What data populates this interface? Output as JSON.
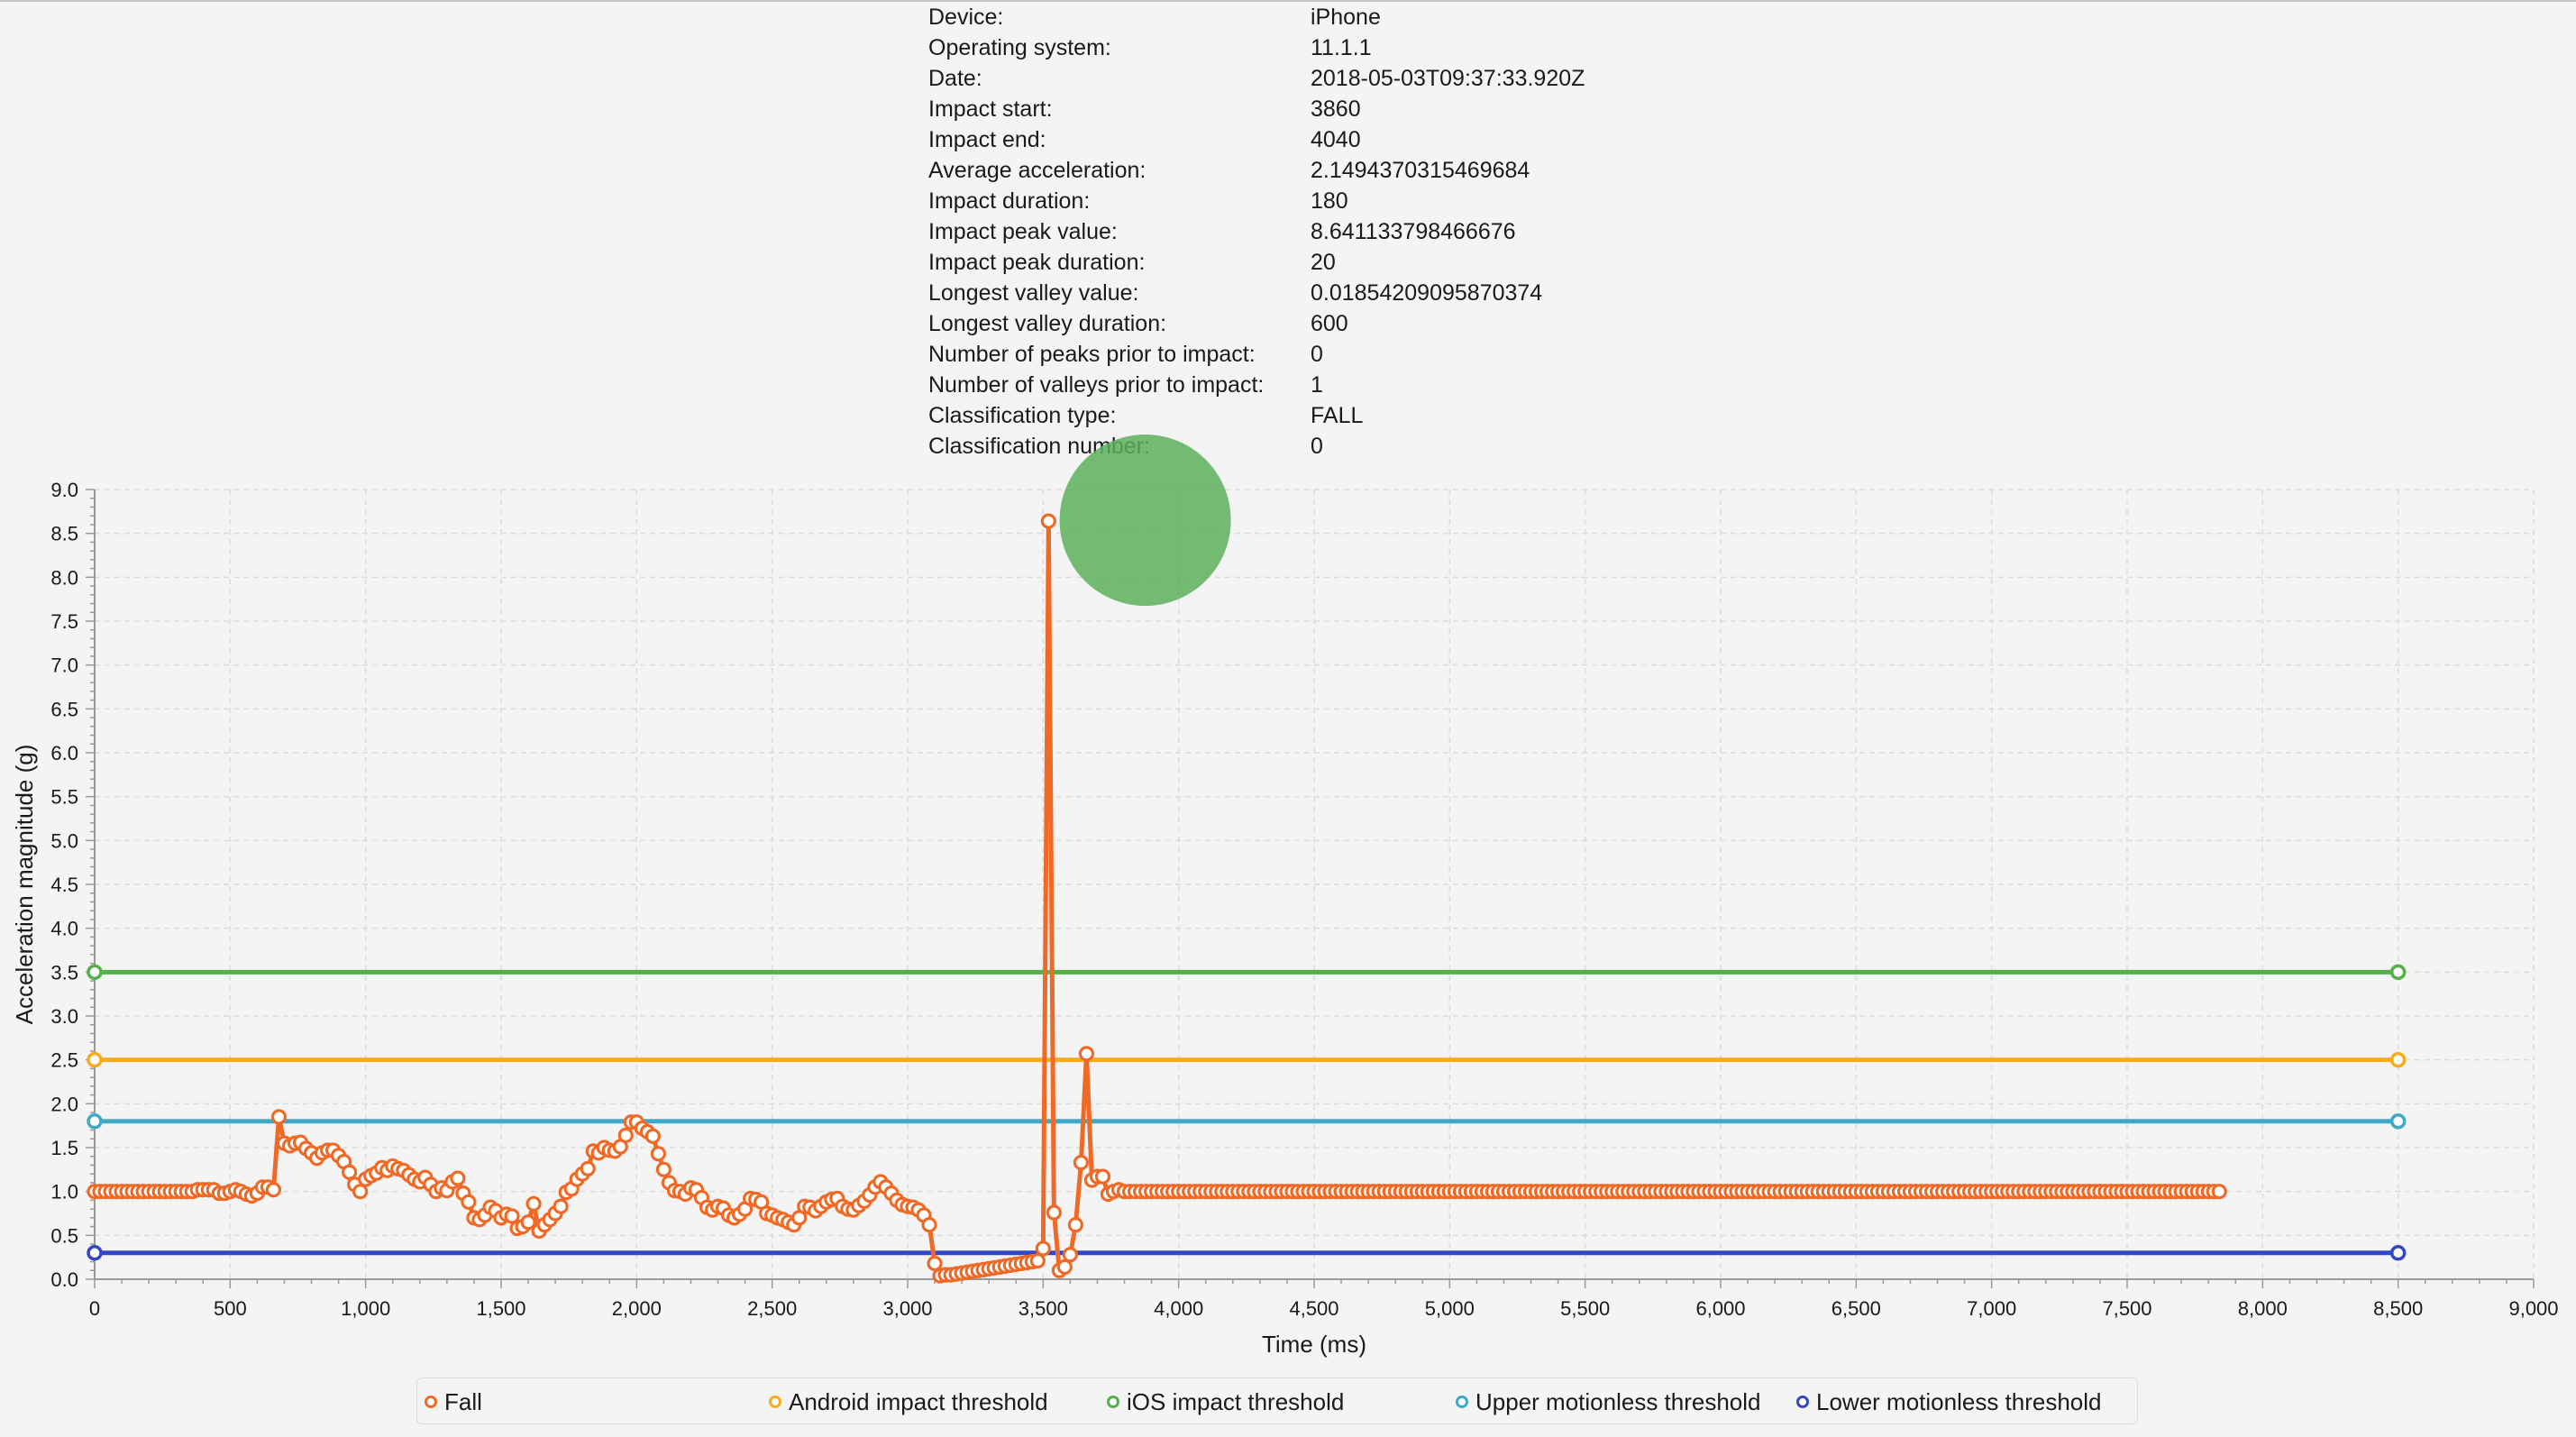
{
  "info": [
    {
      "label": "Device:",
      "value": "iPhone"
    },
    {
      "label": "Operating system:",
      "value": "11.1.1"
    },
    {
      "label": "Date:",
      "value": "2018-05-03T09:37:33.920Z"
    },
    {
      "label": "Impact start:",
      "value": "3860"
    },
    {
      "label": "Impact end:",
      "value": "4040"
    },
    {
      "label": "Average acceleration:",
      "value": "2.1494370315469684"
    },
    {
      "label": "Impact duration:",
      "value": "180"
    },
    {
      "label": "Impact peak value:",
      "value": "8.641133798466676"
    },
    {
      "label": "Impact peak duration:",
      "value": "20"
    },
    {
      "label": "Longest valley value:",
      "value": "0.01854209095870374"
    },
    {
      "label": "Longest valley duration:",
      "value": "600"
    },
    {
      "label": "Number of peaks prior to impact:",
      "value": "0"
    },
    {
      "label": "Number of valleys prior to impact:",
      "value": "1"
    },
    {
      "label": "Classification type:",
      "value": "FALL"
    },
    {
      "label": "Classification number:",
      "value": "0"
    }
  ],
  "chart_data": {
    "type": "line",
    "xlabel": "Time (ms)",
    "ylabel": "Acceleration magnitude (g)",
    "xlim": [
      0,
      9000
    ],
    "ylim": [
      0,
      9.0
    ],
    "xticks": [
      0,
      500,
      1000,
      1500,
      2000,
      2500,
      3000,
      3500,
      4000,
      4500,
      5000,
      5500,
      6000,
      6500,
      7000,
      7500,
      8000,
      8500,
      9000
    ],
    "xtick_labels": [
      "0",
      "500",
      "1,000",
      "1,500",
      "2,000",
      "2,500",
      "3,000",
      "3,500",
      "4,000",
      "4,500",
      "5,000",
      "5,500",
      "6,000",
      "6,500",
      "7,000",
      "7,500",
      "8,000",
      "8,500",
      "9,000"
    ],
    "yticks": [
      0,
      0.5,
      1,
      1.5,
      2,
      2.5,
      3,
      3.5,
      4,
      4.5,
      5,
      5.5,
      6,
      6.5,
      7,
      7.5,
      8,
      8.5,
      9
    ],
    "ytick_labels": [
      "0.0",
      "0.5",
      "1.0",
      "1.5",
      "2.0",
      "2.5",
      "3.0",
      "3.5",
      "4.0",
      "4.5",
      "5.0",
      "5.5",
      "6.0",
      "6.5",
      "7.0",
      "7.5",
      "8.0",
      "8.5",
      "9.0"
    ],
    "grid": true,
    "legend_position": "bottom",
    "highlight": {
      "x": 3880,
      "y": 8.64,
      "color": "#5cb05c"
    },
    "series": [
      {
        "name": "Fall",
        "color": "#f06a27",
        "sample_interval": 20,
        "x_start": 0,
        "values": [
          1.0,
          1.0,
          1.0,
          1.0,
          1.0,
          1.0,
          1.0,
          1.0,
          1.0,
          1.0,
          1.0,
          1.0,
          1.0,
          1.0,
          1.0,
          1.0,
          1.0,
          1.0,
          1.0,
          1.02,
          1.02,
          1.02,
          1.02,
          0.98,
          0.98,
          1.0,
          1.02,
          1.0,
          0.97,
          0.95,
          0.98,
          1.05,
          1.05,
          1.02,
          1.85,
          1.55,
          1.52,
          1.55,
          1.56,
          1.49,
          1.44,
          1.38,
          1.44,
          1.47,
          1.47,
          1.41,
          1.34,
          1.22,
          1.08,
          1.0,
          1.14,
          1.18,
          1.21,
          1.27,
          1.24,
          1.29,
          1.26,
          1.24,
          1.19,
          1.14,
          1.11,
          1.16,
          1.08,
          1.0,
          1.04,
          1.01,
          1.11,
          1.15,
          0.98,
          0.88,
          0.7,
          0.68,
          0.73,
          0.82,
          0.78,
          0.7,
          0.74,
          0.72,
          0.58,
          0.6,
          0.65,
          0.86,
          0.55,
          0.62,
          0.68,
          0.75,
          0.83,
          0.99,
          1.03,
          1.14,
          1.2,
          1.26,
          1.46,
          1.44,
          1.5,
          1.47,
          1.46,
          1.51,
          1.64,
          1.79,
          1.79,
          1.72,
          1.68,
          1.63,
          1.43,
          1.25,
          1.1,
          1.01,
          1.0,
          0.97,
          1.04,
          1.02,
          0.93,
          0.82,
          0.79,
          0.83,
          0.81,
          0.73,
          0.7,
          0.74,
          0.8,
          0.92,
          0.91,
          0.88,
          0.75,
          0.73,
          0.7,
          0.68,
          0.65,
          0.62,
          0.7,
          0.83,
          0.82,
          0.78,
          0.83,
          0.88,
          0.91,
          0.92,
          0.83,
          0.8,
          0.79,
          0.84,
          0.89,
          0.96,
          1.05,
          1.11,
          1.05,
          0.98,
          0.9,
          0.85,
          0.83,
          0.82,
          0.79,
          0.73,
          0.62,
          0.18,
          0.04,
          0.05,
          0.05,
          0.06,
          0.07,
          0.08,
          0.09,
          0.1,
          0.11,
          0.12,
          0.13,
          0.14,
          0.15,
          0.16,
          0.17,
          0.18,
          0.19,
          0.2,
          0.21,
          0.35,
          8.64,
          0.76,
          0.1,
          0.14,
          0.28,
          0.62,
          1.33,
          2.57,
          1.13,
          1.17,
          1.17,
          0.97,
          1.0,
          1.02,
          1.0,
          1.0,
          1.0,
          1.0,
          1.0,
          1.0,
          1.0,
          1.0,
          1.0,
          1.0,
          1.0,
          1.0,
          1.0,
          1.0,
          1.0,
          1.0,
          1.0,
          1.0,
          1.0,
          1.0,
          1.0,
          1.0,
          1.0,
          1.0,
          1.0,
          1.0,
          1.0,
          1.0,
          1.0,
          1.0,
          1.0,
          1.0,
          1.0,
          1.0,
          1.0,
          1.0,
          1.0,
          1.0,
          1.0,
          1.0,
          1.0,
          1.0,
          1.0,
          1.0,
          1.0,
          1.0,
          1.0,
          1.0,
          1.0,
          1.0,
          1.0,
          1.0,
          1.0,
          1.0,
          1.0,
          1.0,
          1.0,
          1.0,
          1.0,
          1.0,
          1.0,
          1.0,
          1.0,
          1.0,
          1.0,
          1.0,
          1.0,
          1.0,
          1.0,
          1.0,
          1.0,
          1.0,
          1.0,
          1.0,
          1.0,
          1.0,
          1.0,
          1.0,
          1.0,
          1.0,
          1.0,
          1.0,
          1.0,
          1.0,
          1.0,
          1.0,
          1.0,
          1.0,
          1.0,
          1.0,
          1.0,
          1.0,
          1.0,
          1.0,
          1.0,
          1.0,
          1.0,
          1.0,
          1.0,
          1.0,
          1.0,
          1.0,
          1.0,
          1.0,
          1.0,
          1.0,
          1.0,
          1.0,
          1.0,
          1.0,
          1.0,
          1.0,
          1.0,
          1.0,
          1.0,
          1.0,
          1.0,
          1.0,
          1.0,
          1.0,
          1.0,
          1.0,
          1.0,
          1.0,
          1.0,
          1.0,
          1.0,
          1.0,
          1.0,
          1.0,
          1.0,
          1.0,
          1.0,
          1.0,
          1.0,
          1.0,
          1.0,
          1.0,
          1.0,
          1.0,
          1.0,
          1.0,
          1.0,
          1.0,
          1.0,
          1.0,
          1.0,
          1.0,
          1.0,
          1.0,
          1.0,
          1.0,
          1.0,
          1.0,
          1.0,
          1.0,
          1.0,
          1.0,
          1.0,
          1.0,
          1.0,
          1.0,
          1.0,
          1.0,
          1.0,
          1.0,
          1.0,
          1.0,
          1.0,
          1.0,
          1.0,
          1.0,
          1.0,
          1.0,
          1.0,
          1.0,
          1.0,
          1.0,
          1.0,
          1.0,
          1.0,
          1.0,
          1.0,
          1.0,
          1.0,
          1.0,
          1.0,
          1.0,
          1.0,
          1.0,
          1.0,
          1.0,
          1.0,
          1.0,
          1.0,
          1.0,
          1.0,
          1.0,
          1.0,
          1.0,
          1.0,
          1.0,
          1.0
        ]
      },
      {
        "name": "Android impact threshold",
        "color": "#f7ab1f",
        "x": [
          0,
          8500
        ],
        "y": [
          2.5,
          2.5
        ]
      },
      {
        "name": "iOS impact threshold",
        "color": "#55b04a",
        "x": [
          0,
          8500
        ],
        "y": [
          3.5,
          3.5
        ]
      },
      {
        "name": "Upper motionless threshold",
        "color": "#3fa9c8",
        "x": [
          0,
          8500
        ],
        "y": [
          1.8,
          1.8
        ]
      },
      {
        "name": "Lower motionless threshold",
        "color": "#3346c6",
        "x": [
          0,
          8500
        ],
        "y": [
          0.3,
          0.3
        ]
      }
    ]
  }
}
